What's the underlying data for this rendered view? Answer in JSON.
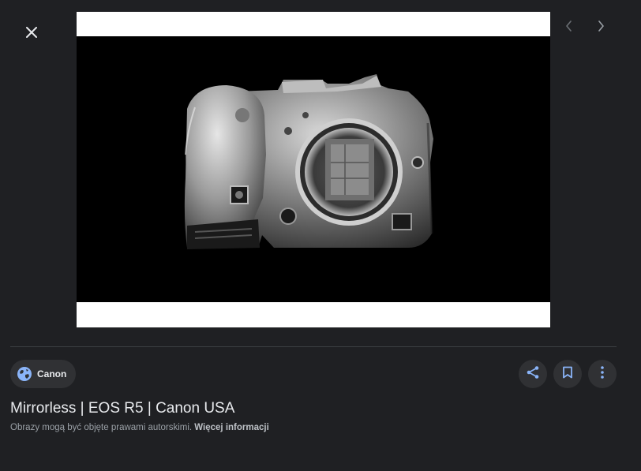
{
  "viewer": {
    "close_icon": "close-icon",
    "prev_icon": "chevron-left-icon",
    "next_icon": "chevron-right-icon"
  },
  "image": {
    "subject": "camera-body-front"
  },
  "source": {
    "label": "Canon",
    "icon": "globe-icon"
  },
  "actions": {
    "share_icon": "share-icon",
    "save_icon": "bookmark-icon",
    "more_icon": "more-vert-icon"
  },
  "result": {
    "title": "Mirrorless | EOS R5 | Canon USA",
    "copyright_text": "Obrazy mogą być objęte prawami autorskimi.",
    "more_info_label": "Więcej informacji"
  },
  "colors": {
    "background": "#1f2023",
    "chip": "#303134",
    "accent": "#8ab4f8",
    "text": "#e8eaed",
    "muted": "#9aa0a6"
  }
}
